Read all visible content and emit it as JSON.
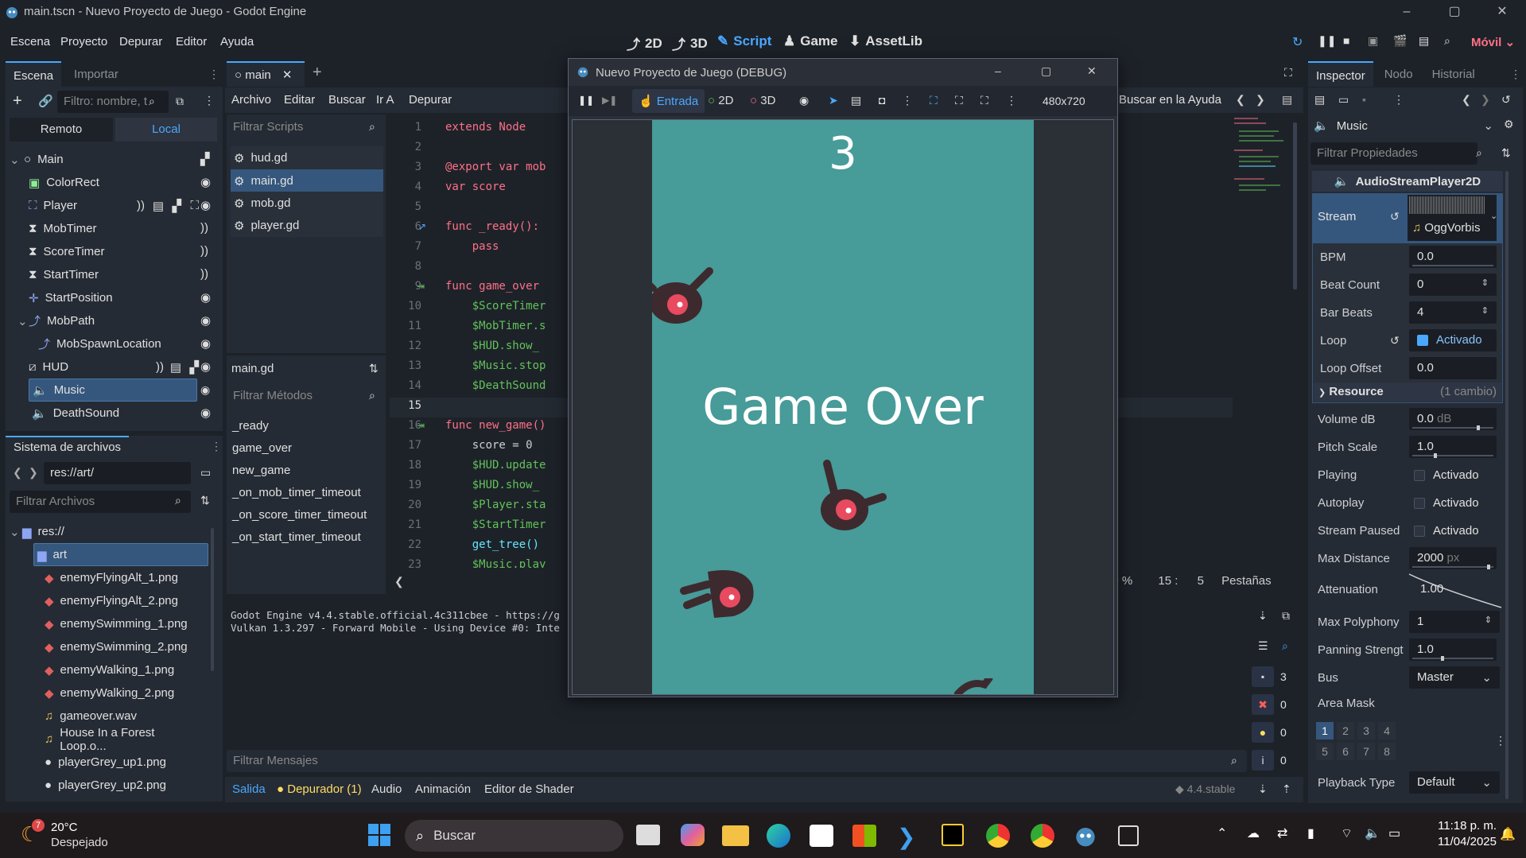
{
  "window": {
    "title": "main.tscn - Nuevo Proyecto de Juego - Godot Engine"
  },
  "menu": {
    "items": [
      "Escena",
      "Proyecto",
      "Depurar",
      "Editor",
      "Ayuda"
    ]
  },
  "workspaces": {
    "items": [
      "2D",
      "3D",
      "Script",
      "Game",
      "AssetLib"
    ],
    "active": "Script"
  },
  "renderer": {
    "label": "Móvil"
  },
  "scene_dock": {
    "tabs": [
      "Escena",
      "Importar"
    ],
    "filter_placeholder": "Filtro: nombre, t",
    "remote_label": "Remoto",
    "local_label": "Local",
    "nodes": [
      {
        "name": "Main"
      },
      {
        "name": "ColorRect"
      },
      {
        "name": "Player"
      },
      {
        "name": "MobTimer"
      },
      {
        "name": "ScoreTimer"
      },
      {
        "name": "StartTimer"
      },
      {
        "name": "StartPosition"
      },
      {
        "name": "MobPath"
      },
      {
        "name": "MobSpawnLocation"
      },
      {
        "name": "HUD"
      },
      {
        "name": "Music"
      },
      {
        "name": "DeathSound"
      }
    ]
  },
  "filesystem": {
    "title": "Sistema de archivos",
    "path": "res://art/",
    "filter_placeholder": "Filtrar Archivos",
    "items": [
      "res://",
      "art",
      "enemyFlyingAlt_1.png",
      "enemyFlyingAlt_2.png",
      "enemySwimming_1.png",
      "enemySwimming_2.png",
      "enemyWalking_1.png",
      "enemyWalking_2.png",
      "gameover.wav",
      "House In a Forest Loop.o...",
      "playerGrey_up1.png",
      "playerGrey_up2.png"
    ]
  },
  "script_editor": {
    "tab": "main",
    "menu": [
      "Archivo",
      "Editar",
      "Buscar",
      "Ir A",
      "Depurar"
    ],
    "filter_scripts": "Filtrar Scripts",
    "scripts": [
      "hud.gd",
      "main.gd",
      "mob.gd",
      "player.gd"
    ],
    "current_script": "main.gd",
    "filter_methods": "Filtrar Métodos",
    "methods": [
      "_ready",
      "game_over",
      "new_game",
      "_on_mob_timer_timeout",
      "_on_score_timer_timeout",
      "_on_start_timer_timeout"
    ],
    "line_numbers": [
      "1",
      "2",
      "3",
      "4",
      "5",
      "6",
      "7",
      "8",
      "9",
      "10",
      "11",
      "12",
      "13",
      "14",
      "15",
      "16",
      "17",
      "18",
      "19",
      "20",
      "21",
      "22",
      "23"
    ],
    "code": [
      "extends Node",
      "",
      "@export var mob",
      "var score",
      "",
      "func _ready():",
      "    pass",
      "",
      "func game_over",
      "    $ScoreTimer",
      "    $MobTimer.s",
      "    $HUD.show_",
      "    $Music.stop",
      "    $DeathSound",
      "",
      "func new_game()",
      "    score = 0",
      "    $HUD.update",
      "    $HUD.show_",
      "    $Player.sta",
      "    $StartTimer",
      "    get_tree()",
      "    $Music.play"
    ],
    "help_search": "Buscar en la Ayuda",
    "status": {
      "zoom": "00 %",
      "line": "15",
      "col": "5",
      "indent": "Pestañas"
    }
  },
  "output": {
    "lines": [
      "Godot Engine v4.4.stable.official.4c311cbee - https://g",
      "Vulkan 1.3.297 - Forward Mobile - Using Device #0: Inte"
    ],
    "filter_placeholder": "Filtrar Mensajes",
    "bottom_tabs": [
      "Salida",
      "Depurador (1)",
      "Audio",
      "Animación",
      "Editor de Shader"
    ],
    "version": "4.4.stable",
    "counts": {
      "log": "3",
      "errors": "0",
      "warnings": "0",
      "info": "0"
    }
  },
  "game_window": {
    "title": "Nuevo Proyecto de Juego (DEBUG)",
    "input_label": "Entrada",
    "mode_2d": "2D",
    "mode_3d": "3D",
    "resolution": "480x720",
    "score": "3",
    "message": "Game Over"
  },
  "inspector": {
    "tabs": [
      "Inspector",
      "Nodo",
      "Historial"
    ],
    "node_name": "Music",
    "filter_placeholder": "Filtrar Propiedades",
    "class_name": "AudioStreamPlayer2D",
    "stream": {
      "label": "Stream",
      "value": "OggVorbis"
    },
    "sub_props": [
      {
        "label": "BPM",
        "value": "0.0"
      },
      {
        "label": "Beat Count",
        "value": "0"
      },
      {
        "label": "Bar Beats",
        "value": "4"
      },
      {
        "label": "Loop",
        "value": "Activado"
      },
      {
        "label": "Loop Offset",
        "value": "0.0"
      }
    ],
    "resource": {
      "label": "Resource",
      "changes": "(1 cambio)"
    },
    "props": [
      {
        "label": "Volume dB",
        "value": "0.0",
        "unit": "dB"
      },
      {
        "label": "Pitch Scale",
        "value": "1.0"
      },
      {
        "label": "Playing",
        "value": "Activado"
      },
      {
        "label": "Autoplay",
        "value": "Activado"
      },
      {
        "label": "Stream Paused",
        "value": "Activado"
      },
      {
        "label": "Max Distance",
        "value": "2000",
        "unit": "px"
      },
      {
        "label": "Attenuation",
        "value": "1.00"
      },
      {
        "label": "Max Polyphony",
        "value": "1"
      },
      {
        "label": "Panning Strengt",
        "value": "1.0"
      },
      {
        "label": "Bus",
        "value": "Master"
      },
      {
        "label": "Area Mask",
        "value": ""
      },
      {
        "label": "Playback Type",
        "value": "Default"
      }
    ],
    "area_mask_bits": [
      "1",
      "2",
      "3",
      "4",
      "5",
      "6",
      "7",
      "8"
    ]
  },
  "taskbar": {
    "weather_temp": "20°C",
    "weather_desc": "Despejado",
    "weather_badge": "7",
    "search": "Buscar",
    "time": "11:18 p. m.",
    "date": "11/04/2025"
  },
  "colors": {
    "accent": "#4aa8ff",
    "game_bg": "#479b99",
    "selection": "#35577d"
  }
}
